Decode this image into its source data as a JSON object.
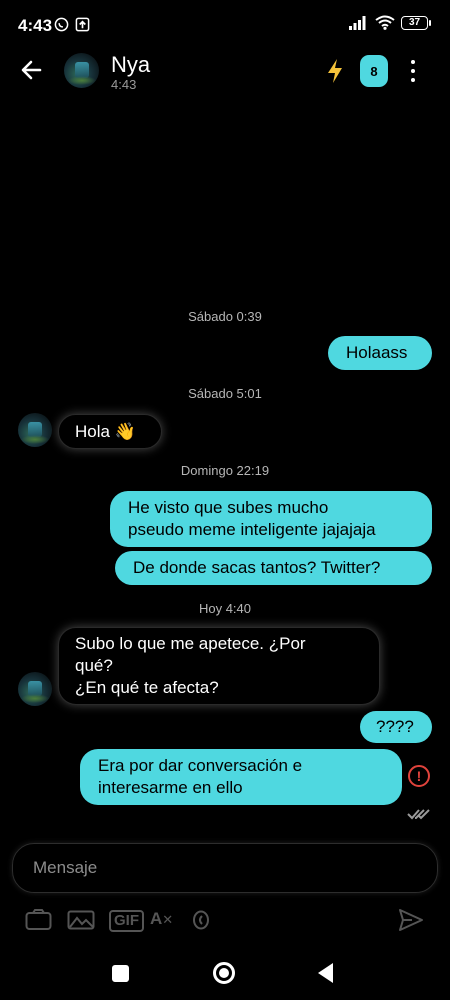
{
  "status_bar": {
    "time": "4:43",
    "battery": "37",
    "icons": [
      "whatsapp-status-icon",
      "upload-icon",
      "signal-icon",
      "wifi-icon",
      "battery-icon"
    ]
  },
  "header": {
    "contact_name": "Nya",
    "last_seen": "4:43",
    "badge_count": "8",
    "icons": [
      "back-arrow-icon",
      "lightning-icon",
      "more-vert-icon"
    ]
  },
  "messages": [
    {
      "type": "date",
      "text": "Sábado 0:39"
    },
    {
      "type": "outgoing",
      "lines": [
        "Holaass"
      ]
    },
    {
      "type": "date",
      "text": "Sábado 5:01"
    },
    {
      "type": "incoming",
      "lines": [
        "Hola 👋"
      ]
    },
    {
      "type": "date",
      "text": "Domingo 22:19"
    },
    {
      "type": "outgoing",
      "lines": [
        "He visto que subes mucho",
        "pseudo meme inteligente jajajaja"
      ]
    },
    {
      "type": "outgoing",
      "lines": [
        "De donde sacas tantos? Twitter?"
      ]
    },
    {
      "type": "date",
      "text": "Hoy 4:40"
    },
    {
      "type": "incoming",
      "lines": [
        "Subo lo que me apetece. ¿Por",
        "qué?",
        "¿En qué te afecta?"
      ]
    },
    {
      "type": "outgoing",
      "lines": [
        "????"
      ]
    },
    {
      "type": "outgoing",
      "lines": [
        "Era por dar conversación e",
        "interesarme en ello"
      ],
      "status": "error"
    }
  ],
  "composer": {
    "placeholder": "Mensaje",
    "toolbar": {
      "gif_label": "GIF",
      "translate_label": "A",
      "icons": [
        "camera-icon",
        "image-icon",
        "gif-icon",
        "translate-icon",
        "coin-icon",
        "send-icon"
      ]
    }
  },
  "accent_color": "#4fd8e0",
  "error_color": "#e0433c"
}
